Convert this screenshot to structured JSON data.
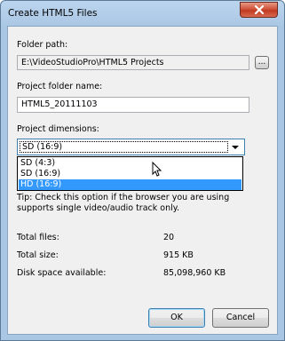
{
  "window": {
    "title": "Create HTML5 Files"
  },
  "folder_path": {
    "label": "Folder path:",
    "value": "E:\\VideoStudioPro\\HTML5 Projects",
    "browse_label": "..."
  },
  "project_folder": {
    "label": "Project folder name:",
    "value": "HTML5_20111103"
  },
  "dimensions": {
    "label": "Project dimensions:",
    "selected": "SD (16:9)",
    "options": [
      "SD (4:3)",
      "SD (16:9)",
      "HD (16:9)"
    ],
    "highlighted": "HD (16:9)"
  },
  "tip": {
    "line1": "Tip: Check this option if the browser you are using",
    "line2": "supports single video/audio track only."
  },
  "stats": {
    "total_files_label": "Total files:",
    "total_files_value": "20",
    "total_size_label": "Total size:",
    "total_size_value": "915 KB",
    "disk_space_label": "Disk space available:",
    "disk_space_value": "85,098,960 KB"
  },
  "buttons": {
    "ok": "OK",
    "cancel": "Cancel"
  }
}
